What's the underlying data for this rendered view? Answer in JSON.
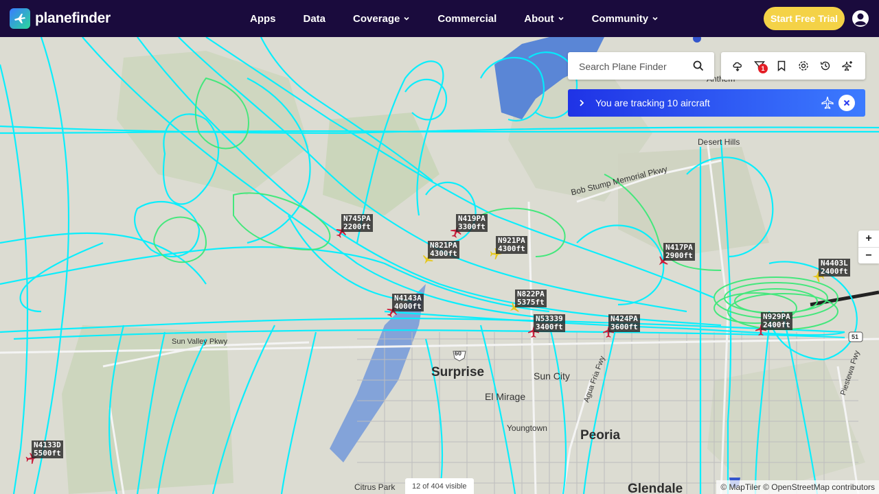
{
  "header": {
    "logo_text": "planefinder",
    "nav": [
      {
        "label": "Apps",
        "has_menu": false
      },
      {
        "label": "Data",
        "has_menu": false
      },
      {
        "label": "Coverage",
        "has_menu": true
      },
      {
        "label": "Commercial",
        "has_menu": false
      },
      {
        "label": "About",
        "has_menu": true
      },
      {
        "label": "Community",
        "has_menu": true
      }
    ],
    "cta_label": "Start Free Trial"
  },
  "search": {
    "placeholder": "Search Plane Finder"
  },
  "toolbar": {
    "tools": [
      "weather-icon",
      "filter-icon",
      "bookmark-icon",
      "settings-icon",
      "history-icon",
      "aircraft-add-icon"
    ],
    "filter_badge": "1"
  },
  "tracking": {
    "message": "You are tracking 10 aircraft"
  },
  "zoom": {
    "in_label": "+",
    "out_label": "−"
  },
  "map": {
    "visible_count": "12 of 404 visible",
    "attribution": "© MapTiler © OpenStreetMap contributors",
    "places": [
      {
        "name": "Surprise",
        "size": "big"
      },
      {
        "name": "Peoria",
        "size": "big"
      },
      {
        "name": "Glendale",
        "size": "big"
      },
      {
        "name": "Sun City",
        "size": "mid"
      },
      {
        "name": "El Mirage",
        "size": "mid"
      },
      {
        "name": "Youngtown",
        "size": "small"
      },
      {
        "name": "Citrus Park",
        "size": "small"
      },
      {
        "name": "Desert Hills",
        "size": "small"
      },
      {
        "name": "Anthem",
        "size": "small"
      },
      {
        "name": "Bob Stump Memorial Pkwy",
        "size": "small"
      },
      {
        "name": "Sun Valley Pkwy",
        "size": "small"
      },
      {
        "name": "Agua Fria Fwy",
        "size": "small"
      },
      {
        "name": "Piestewa Fwy",
        "size": "small"
      }
    ],
    "highway_shields": [
      "60",
      "51"
    ]
  },
  "aircraft": [
    {
      "reg": "N745PA",
      "alt": "2200ft",
      "color": "#c81e3c"
    },
    {
      "reg": "N419PA",
      "alt": "3300ft",
      "color": "#c81e3c"
    },
    {
      "reg": "N821PA",
      "alt": "4300ft",
      "color": "#e6c81e"
    },
    {
      "reg": "N921PA",
      "alt": "4300ft",
      "color": "#e6c81e"
    },
    {
      "reg": "N417PA",
      "alt": "2900ft",
      "color": "#c81e3c"
    },
    {
      "reg": "N4403L",
      "alt": "2400ft",
      "color": "#e6c81e"
    },
    {
      "reg": "N4143A",
      "alt": "4000ft",
      "color": "#c81e3c"
    },
    {
      "reg": "N822PA",
      "alt": "5375ft",
      "color": "#e6c81e"
    },
    {
      "reg": "N53339",
      "alt": "3400ft",
      "color": "#c81e3c"
    },
    {
      "reg": "N424PA",
      "alt": "3600ft",
      "color": "#c81e3c"
    },
    {
      "reg": "N929PA",
      "alt": "2400ft",
      "color": "#c81e3c"
    },
    {
      "reg": "N4133D",
      "alt": "5500ft",
      "color": "#c81e3c"
    }
  ],
  "colors": {
    "header_bg": "#1a0b3d",
    "cta": "#f4d247",
    "track_primary": "#00f0ff",
    "track_low": "#3ce878",
    "tracking_bar": "#2a4cf0",
    "water": "#5a86d6",
    "park": "#c8d4b8"
  }
}
